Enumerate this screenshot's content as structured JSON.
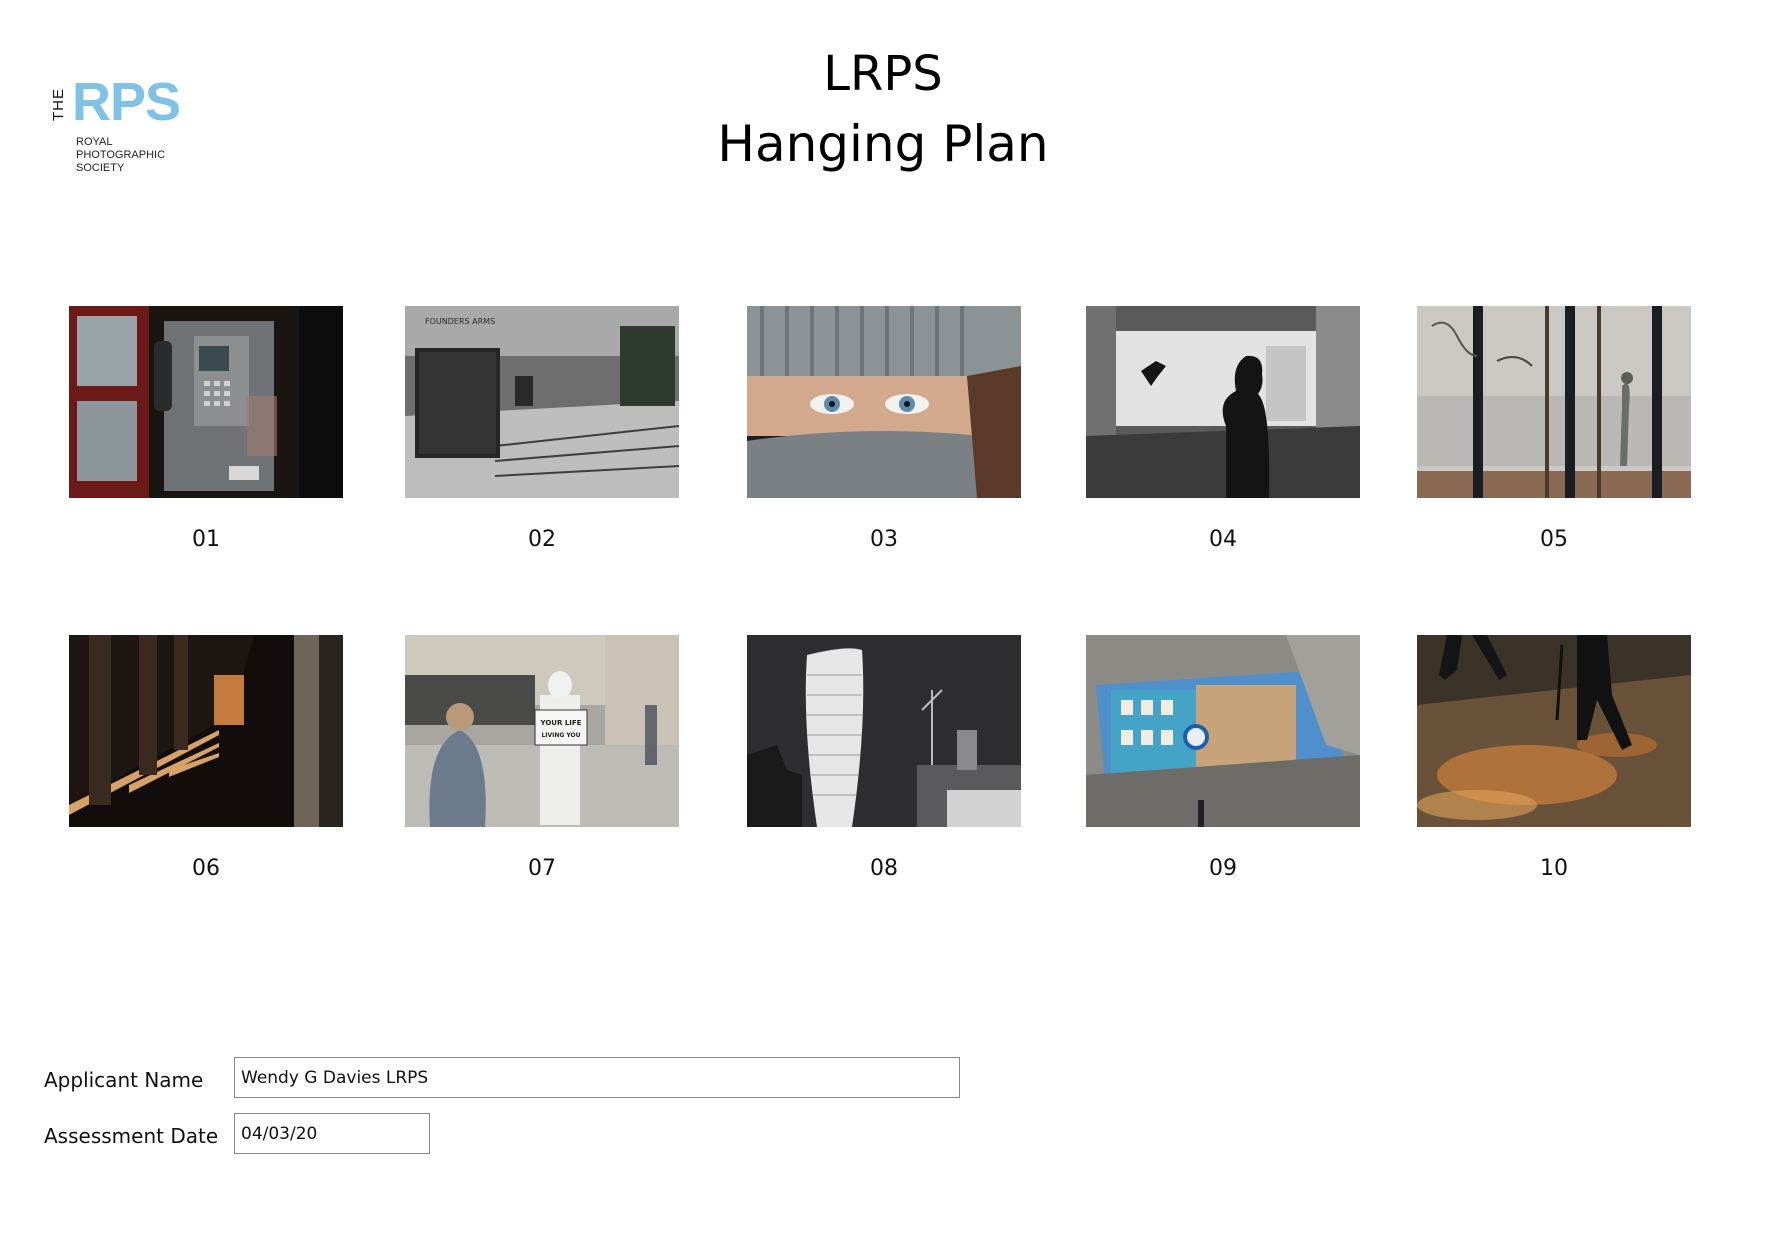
{
  "logo": {
    "the": "THE",
    "rps": "RPS",
    "line1": "ROYAL",
    "line2": "PHOTOGRAPHIC",
    "line3": "SOCIETY"
  },
  "header": {
    "title": "LRPS",
    "subtitle": "Hanging Plan"
  },
  "photos": [
    {
      "number": "01",
      "subject": "phone-box"
    },
    {
      "number": "02",
      "subject": "founders-arms-steps"
    },
    {
      "number": "03",
      "subject": "eyes-woolly-hat"
    },
    {
      "number": "04",
      "subject": "silhouette-pigeon"
    },
    {
      "number": "05",
      "subject": "graffiti-railings"
    },
    {
      "number": "06",
      "subject": "colonnade-shadows"
    },
    {
      "number": "07",
      "subject": "rabbit-costume-sign"
    },
    {
      "number": "08",
      "subject": "walkie-talkie-building"
    },
    {
      "number": "09",
      "subject": "puddle-reflection-street"
    },
    {
      "number": "10",
      "subject": "wet-pavement-walkers"
    }
  ],
  "form": {
    "applicant_label": "Applicant Name",
    "applicant_value": "Wendy G Davies LRPS",
    "date_label": "Assessment Date",
    "date_value": "04/03/20"
  },
  "colors": {
    "logo_blue": "#7ec3e5"
  }
}
